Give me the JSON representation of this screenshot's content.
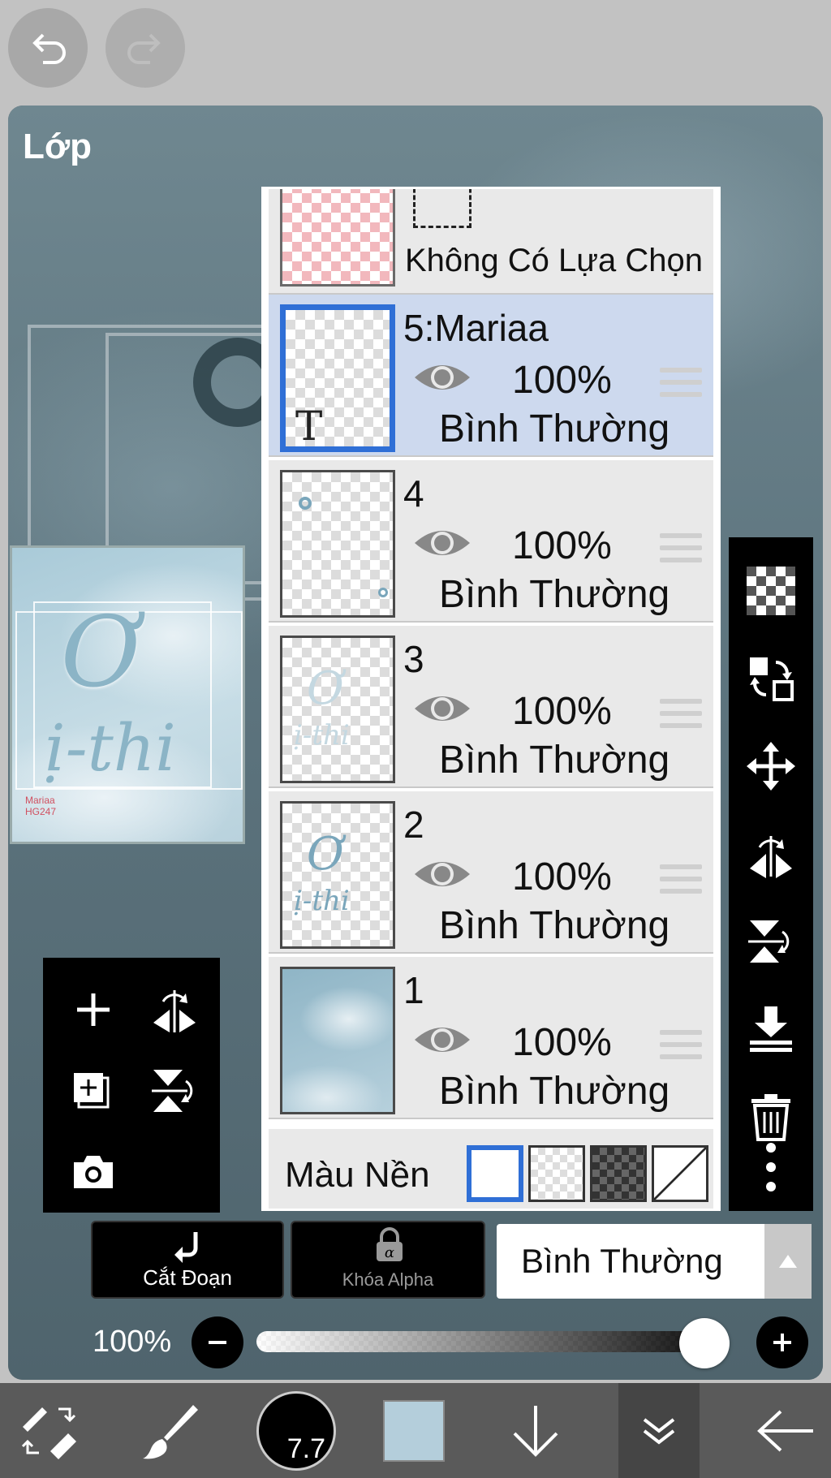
{
  "topbar": {
    "undo_icon": "undo-icon",
    "redo_icon": "redo-icon"
  },
  "panel": {
    "title": "Lớp"
  },
  "layers": {
    "selection_row": {
      "label": "Không Có Lựa Chọn"
    },
    "items": [
      {
        "name": "5:Mariaa",
        "opacity": "100%",
        "blend": "Bình Thường",
        "selected": true,
        "thumb_glyph": "T"
      },
      {
        "name": "4",
        "opacity": "100%",
        "blend": "Bình Thường",
        "selected": false
      },
      {
        "name": "3",
        "opacity": "100%",
        "blend": "Bình Thường",
        "selected": false
      },
      {
        "name": "2",
        "opacity": "100%",
        "blend": "Bình Thường",
        "selected": false
      },
      {
        "name": "1",
        "opacity": "100%",
        "blend": "Bình Thường",
        "selected": false
      }
    ],
    "background": {
      "label": "Màu Nền",
      "options": [
        "white",
        "light-checker",
        "dark-checker",
        "none"
      ],
      "selected": "white"
    }
  },
  "preview": {
    "tag_line1": "Mariaa",
    "tag_line2": "HG247",
    "text1": "Ơ",
    "text2": "ị-thi"
  },
  "canvas_text": {
    "line1": "riaa",
    "line2": "247"
  },
  "actions": {
    "clip_label": "Cắt Đoạn",
    "alpha_lock_label": "Khóa Alpha",
    "blend_mode": "Bình Thường"
  },
  "opacity": {
    "label": "100%",
    "value": 1.0
  },
  "bottombar": {
    "brush_size": "7.7",
    "color": "#b4cedb"
  },
  "colors": {
    "accent": "#2f6fd6",
    "selected_row": "#cdd9ee"
  }
}
